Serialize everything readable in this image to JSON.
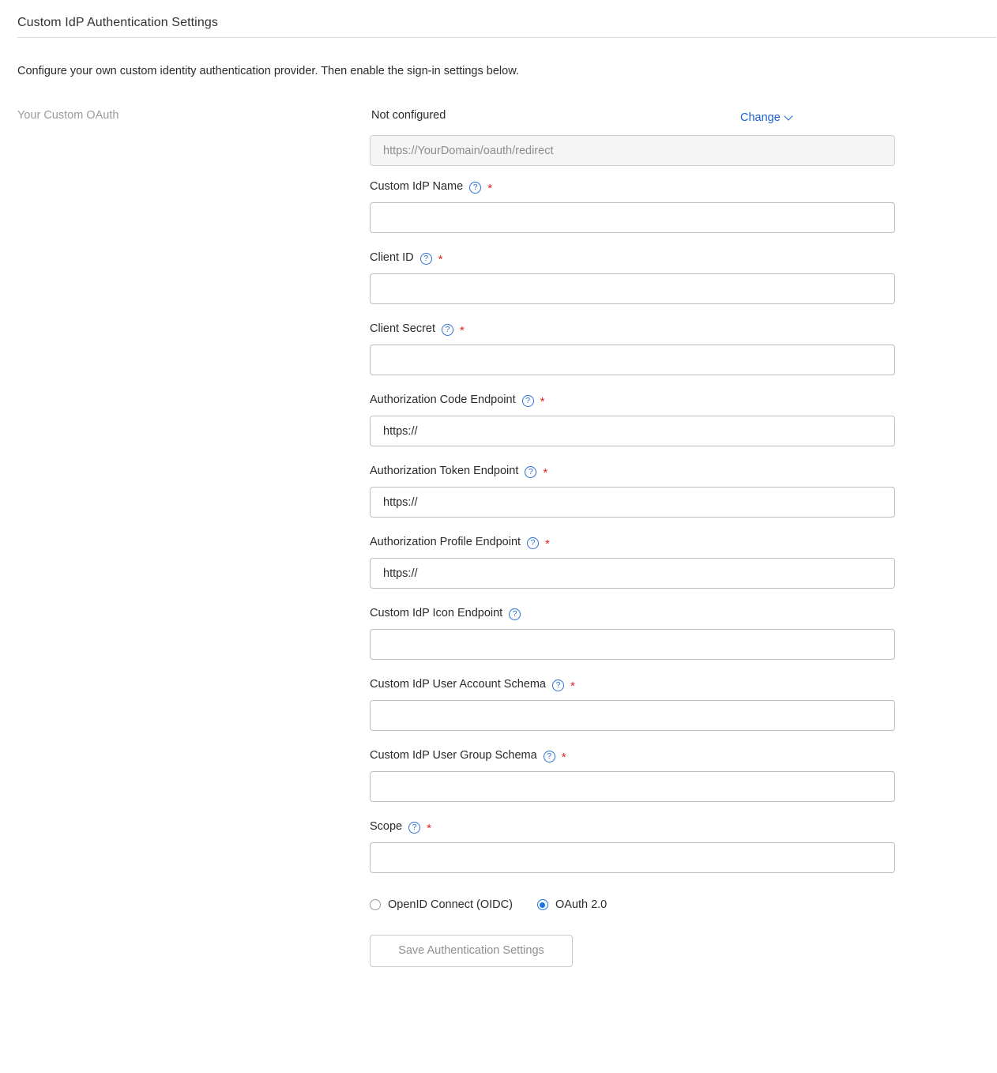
{
  "header": {
    "title": "Custom IdP Authentication Settings",
    "description": "Configure your own custom identity authentication provider. Then enable the sign-in settings below."
  },
  "section": {
    "label": "Your Custom OAuth",
    "status": "Not configured",
    "change_label": "Change",
    "chevron_icon": "chevron-down-icon"
  },
  "redirect": {
    "value": "https://YourDomain/oauth/redirect"
  },
  "help_icon_glyph": "?",
  "required_marker": "*",
  "fields": [
    {
      "label": "Custom IdP Name",
      "value": "",
      "placeholder": "",
      "required": true,
      "help": true
    },
    {
      "label": "Client ID",
      "value": "",
      "placeholder": "",
      "required": true,
      "help": true
    },
    {
      "label": "Client Secret",
      "value": "",
      "placeholder": "",
      "required": true,
      "help": true
    },
    {
      "label": "Authorization Code Endpoint",
      "value": "https://",
      "placeholder": "",
      "required": true,
      "help": true
    },
    {
      "label": "Authorization Token Endpoint",
      "value": "https://",
      "placeholder": "",
      "required": true,
      "help": true
    },
    {
      "label": "Authorization Profile Endpoint",
      "value": "https://",
      "placeholder": "",
      "required": true,
      "help": true
    },
    {
      "label": "Custom IdP Icon Endpoint",
      "value": "",
      "placeholder": "",
      "required": false,
      "help": true
    },
    {
      "label": "Custom IdP User Account Schema",
      "value": "",
      "placeholder": "",
      "required": true,
      "help": true
    },
    {
      "label": "Custom IdP User Group Schema",
      "value": "",
      "placeholder": "",
      "required": true,
      "help": true
    },
    {
      "label": "Scope",
      "value": "",
      "placeholder": "",
      "required": true,
      "help": true
    }
  ],
  "protocol": {
    "options": [
      {
        "label": "OpenID Connect (OIDC)",
        "selected": false
      },
      {
        "label": "OAuth 2.0",
        "selected": true
      }
    ]
  },
  "save": {
    "label": "Save Authentication Settings",
    "disabled": true
  },
  "colors": {
    "link": "#1a62d6",
    "required": "#e02020",
    "help": "#2a6fd6",
    "radio_selected": "#1a73e8",
    "muted_text": "#9a9a9a"
  }
}
